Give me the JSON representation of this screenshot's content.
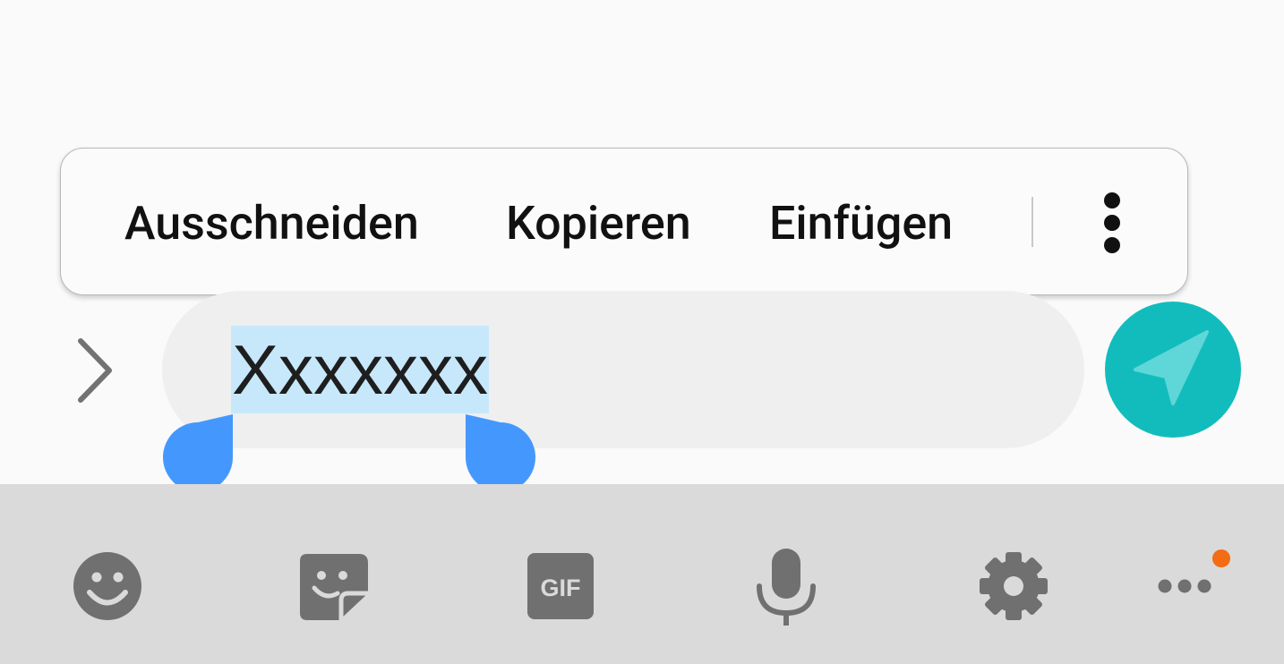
{
  "context_menu": {
    "cut_label": "Ausschneiden",
    "copy_label": "Kopieren",
    "paste_label": "Einfügen",
    "more_icon": "more-vert-icon"
  },
  "composer": {
    "expand_icon": "chevron-right-icon",
    "message_text": "Xxxxxxx",
    "selection_color": "#c7e8fb",
    "handle_color": "#4498fd",
    "send_icon": "send-icon",
    "send_color": "#12bcbd"
  },
  "keyboard_toolbar": {
    "items": [
      "emoji-icon",
      "sticker-icon",
      "gif-icon",
      "microphone-icon",
      "settings-icon",
      "more-horiz-icon"
    ],
    "gif_label": "GIF",
    "notification_color": "#f26d13"
  }
}
